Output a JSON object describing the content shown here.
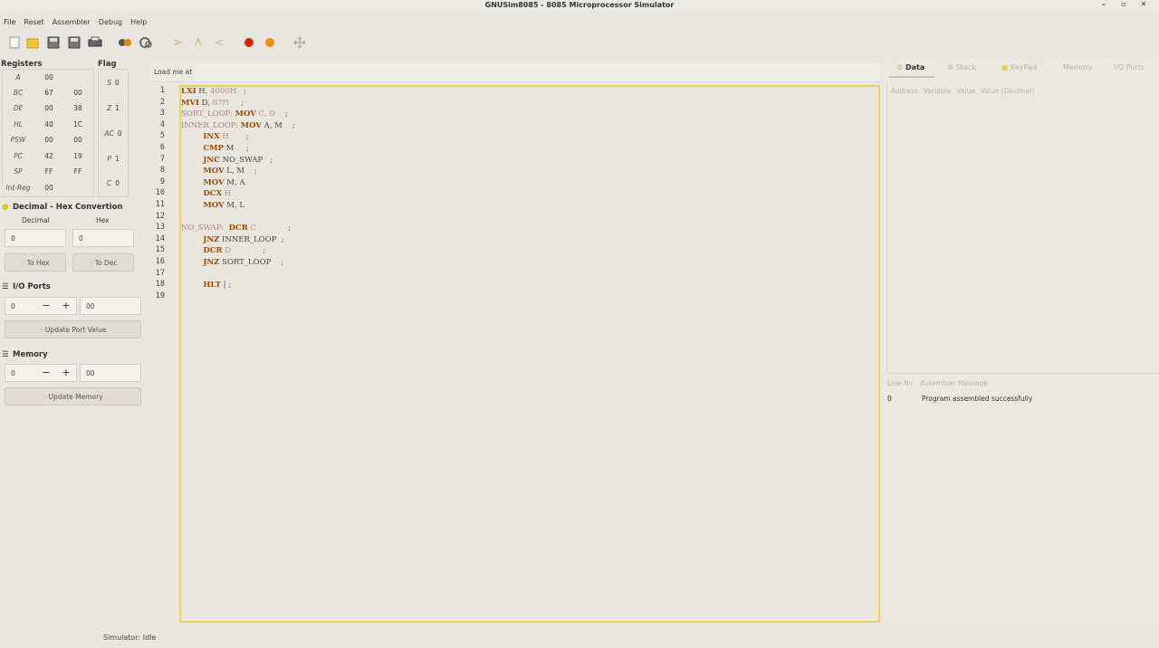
{
  "window": {
    "title": "GNUSim8085 - 8085 Microprocessor Simulator",
    "minimize": "–",
    "maximize": "▫",
    "close": "✕"
  },
  "menu": [
    "File",
    "Reset",
    "Assembler",
    "Debug",
    "Help"
  ],
  "toolbar": [
    "new-icon",
    "open-icon",
    "save-icon",
    "save-as-icon",
    "print-icon",
    "assemble-icon",
    "execute-icon",
    "step-in-icon",
    "step-over-icon",
    "step-out-icon",
    "breakpoint-icon",
    "clear-breakpoints-icon",
    "fullscreen-icon"
  ],
  "registers": {
    "title": "Registers",
    "rows": [
      {
        "name": "A",
        "high": "00",
        "low": ""
      },
      {
        "name": "BC",
        "high": "67",
        "low": "00"
      },
      {
        "name": "DE",
        "high": "00",
        "low": "38"
      },
      {
        "name": "HL",
        "high": "40",
        "low": "1C"
      },
      {
        "name": "PSW",
        "high": "00",
        "low": "00"
      },
      {
        "name": "PC",
        "high": "42",
        "low": "19"
      },
      {
        "name": "SP",
        "high": "FF",
        "low": "FF"
      },
      {
        "name": "Int-Reg",
        "high": "00",
        "low": ""
      }
    ]
  },
  "flags": {
    "title": "Flag",
    "rows": [
      {
        "name": "S",
        "value": "0"
      },
      {
        "name": "Z",
        "value": "1"
      },
      {
        "name": "AC",
        "value": "0"
      },
      {
        "name": "P",
        "value": "1"
      },
      {
        "name": "C",
        "value": "0"
      }
    ]
  },
  "conversion": {
    "title": "Decimal - Hex Convertion",
    "decimal_label": "Decimal",
    "hex_label": "Hex",
    "decimal_value": "0",
    "hex_value": "0",
    "to_hex": "To Hex",
    "to_dec": "To Dec"
  },
  "io_ports": {
    "title": "I/O Ports",
    "port": "0",
    "value": "00",
    "minus": "−",
    "plus": "+",
    "update": "Update Port Value"
  },
  "memory": {
    "title": "Memory",
    "address": "0",
    "value": "00",
    "minus": "−",
    "plus": "+",
    "update": "Update Memory"
  },
  "editor": {
    "load_label": "Load me at",
    "load_value": "",
    "line_numbers": [
      "1",
      "2",
      "3",
      "4",
      "5",
      "6",
      "7",
      "8",
      "9",
      "10",
      "11",
      "12",
      "13",
      "14",
      "15",
      "16",
      "17",
      "18",
      "19"
    ],
    "lines": [
      [
        {
          "t": "LXI",
          "c": "kw"
        },
        {
          "t": " H, ",
          "c": "rg"
        },
        {
          "t": "4000H",
          "c": "op"
        },
        {
          "t": "   ;",
          "c": "cm"
        }
      ],
      [
        {
          "t": "MVI",
          "c": "kw"
        },
        {
          "t": " D, ",
          "c": "rg"
        },
        {
          "t": "07H",
          "c": "op"
        },
        {
          "t": "     ;",
          "c": "cm"
        }
      ],
      [
        {
          "t": "SORT_LOOP:",
          "c": "lb"
        },
        {
          "t": " ",
          "c": "rg"
        },
        {
          "t": "MOV",
          "c": "kw"
        },
        {
          "t": " C, D",
          "c": "op"
        },
        {
          "t": "    ;",
          "c": "cm"
        }
      ],
      [
        {
          "t": "INNER_LOOP:",
          "c": "lb"
        },
        {
          "t": " ",
          "c": "rg"
        },
        {
          "t": "MOV",
          "c": "kw"
        },
        {
          "t": " A, M",
          "c": "rg"
        },
        {
          "t": "    ;",
          "c": "cm"
        }
      ],
      [
        {
          "t": "         ",
          "c": "rg"
        },
        {
          "t": "INX",
          "c": "kw"
        },
        {
          "t": " H",
          "c": "op"
        },
        {
          "t": "       ;",
          "c": "cm"
        }
      ],
      [
        {
          "t": "         ",
          "c": "rg"
        },
        {
          "t": "CMP",
          "c": "kw"
        },
        {
          "t": " M",
          "c": "rg"
        },
        {
          "t": "     ;",
          "c": "cm"
        }
      ],
      [
        {
          "t": "         ",
          "c": "rg"
        },
        {
          "t": "JNC",
          "c": "kw"
        },
        {
          "t": " NO_SWAP",
          "c": "rg"
        },
        {
          "t": "   ;",
          "c": "cm"
        }
      ],
      [
        {
          "t": "         ",
          "c": "rg"
        },
        {
          "t": "MOV",
          "c": "kw"
        },
        {
          "t": " L, M",
          "c": "rg"
        },
        {
          "t": "    ;",
          "c": "cm"
        }
      ],
      [
        {
          "t": "         ",
          "c": "rg"
        },
        {
          "t": "MOV",
          "c": "kw"
        },
        {
          "t": " M, A",
          "c": "rg"
        },
        {
          "t": "",
          "c": "cm"
        }
      ],
      [
        {
          "t": "         ",
          "c": "rg"
        },
        {
          "t": "DCX",
          "c": "kw"
        },
        {
          "t": " H",
          "c": "op"
        },
        {
          "t": "",
          "c": "cm"
        }
      ],
      [
        {
          "t": "         ",
          "c": "rg"
        },
        {
          "t": "MOV",
          "c": "kw"
        },
        {
          "t": " M, L",
          "c": "rg"
        },
        {
          "t": "",
          "c": "cm"
        }
      ],
      [],
      [
        {
          "t": "NO_SWAP:",
          "c": "lb"
        },
        {
          "t": "  ",
          "c": "rg"
        },
        {
          "t": "DCR",
          "c": "kw"
        },
        {
          "t": " C",
          "c": "op"
        },
        {
          "t": "             ;",
          "c": "cm"
        }
      ],
      [
        {
          "t": "         ",
          "c": "rg"
        },
        {
          "t": "JNZ",
          "c": "kw"
        },
        {
          "t": " INNER_LOOP",
          "c": "rg"
        },
        {
          "t": "  ;",
          "c": "cm"
        }
      ],
      [
        {
          "t": "         ",
          "c": "rg"
        },
        {
          "t": "DCR",
          "c": "kw"
        },
        {
          "t": " D",
          "c": "op"
        },
        {
          "t": "             ;",
          "c": "cm"
        }
      ],
      [
        {
          "t": "         ",
          "c": "rg"
        },
        {
          "t": "JNZ",
          "c": "kw"
        },
        {
          "t": " SORT_LOOP",
          "c": "rg"
        },
        {
          "t": "    ;",
          "c": "cm"
        }
      ],
      [],
      [
        {
          "t": "         ",
          "c": "rg"
        },
        {
          "t": "HLT",
          "c": "kw"
        },
        {
          "t": " | ;",
          "c": "cm"
        }
      ],
      []
    ]
  },
  "right_tabs": [
    "Data",
    "Stack",
    "KeyPad",
    "Memory",
    "I/O Ports"
  ],
  "data_columns": [
    "Address",
    "Variable",
    "Value",
    "Value (Decimal)"
  ],
  "messages": {
    "columns": [
      "Line No",
      "Assembler Message"
    ],
    "rows": [
      {
        "line": "0",
        "message": "Program assembled successfully"
      }
    ]
  },
  "status": "Simulator: Idle"
}
